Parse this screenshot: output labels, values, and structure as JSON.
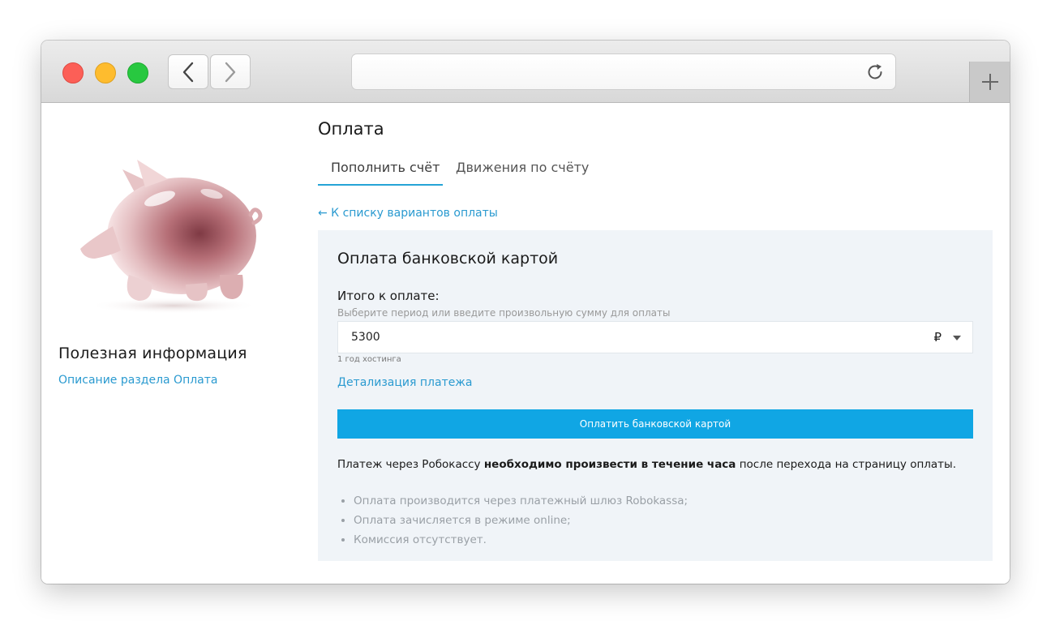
{
  "page": {
    "title": "Оплата",
    "tabs": [
      {
        "label": "Пополнить счёт",
        "active": true
      },
      {
        "label": "Движения по счёту",
        "active": false
      }
    ],
    "back_link": "← К списку вариантов оплаты"
  },
  "sidebar": {
    "title": "Полезная информация",
    "link": "Описание раздела Оплата",
    "image_icon": "piggy-bank-icon"
  },
  "panel": {
    "title": "Оплата банковской картой",
    "total_label": "Итого к оплате:",
    "hint": "Выберите период или введите произвольную сумму для оплаты",
    "amount": "5300",
    "currency": "₽",
    "period_note": "1 год хостинга",
    "details_link": "Детализация платежа",
    "pay_button": "Оплатить банковской картой",
    "notice_start": "Платеж через Робокассу ",
    "notice_bold": "необходимо произвести в течение часа",
    "notice_end": " после перехода на страницу оплаты.",
    "bullets": [
      "Оплата производится через платежный шлюз Robokassa;",
      "Оплата зачисляется в режиме online;",
      "Комиссия отсутствует."
    ]
  },
  "colors": {
    "accent": "#10a6e4",
    "link": "#2a9ad0",
    "panel_bg": "#f0f4f8"
  }
}
